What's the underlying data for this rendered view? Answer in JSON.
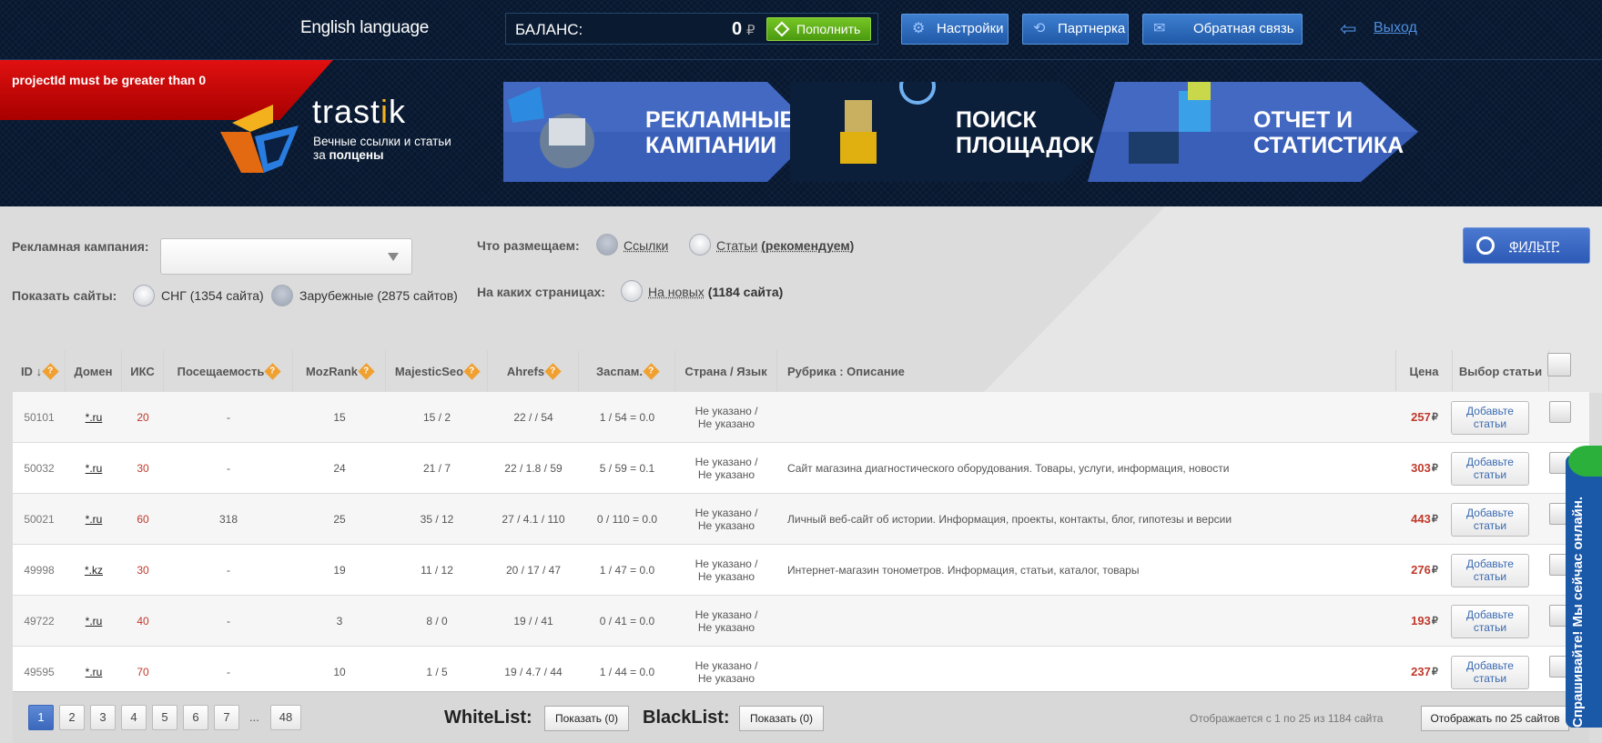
{
  "header": {
    "language": "English language",
    "balance": {
      "label": "БАЛАНС:",
      "amount": "0",
      "currency": "₽",
      "topup_label": "Пополнить"
    },
    "nav": [
      {
        "label": "Настройки",
        "icon": "gear-icon"
      },
      {
        "label": "Партнерка",
        "icon": "refresh-icon"
      },
      {
        "label": "Обратная связь",
        "icon": "mail-icon"
      }
    ],
    "logout_label": "Выход",
    "error_message": "projectId must be greater than 0",
    "logo": {
      "name_a": "trast",
      "name_b": "i",
      "name_c": "k",
      "tagline_a": "Вечные ссылки и статьи",
      "tagline_b": "за ",
      "tagline_c": "полцены"
    },
    "banners": [
      {
        "line1": "РЕКЛАМНЫЕ",
        "line2": "КАМПАНИИ"
      },
      {
        "line1": "ПОИСК",
        "line2": "ПЛОЩАДОК"
      },
      {
        "line1": "ОТЧЕТ И",
        "line2": "СТАТИСТИКА"
      }
    ]
  },
  "filters": {
    "campaign_label": "Рекламная кампания:",
    "show_sites_label": "Показать сайты:",
    "cis_label": "СНГ (1354 сайта)",
    "foreign_label": "Зарубежные (2875 сайтов)",
    "what_label": "Что размещаем:",
    "links_label": "Ссылки",
    "articles_label": "Статьи",
    "articles_note": "(рекомендуем)",
    "pages_label": "На каких страницах:",
    "new_label": "На новых",
    "new_count": "(1184 сайта)",
    "filter_button": "ФИЛЬТР"
  },
  "table": {
    "columns": {
      "id": "ID",
      "sort_arrow": "↓",
      "domain": "Домен",
      "iks": "ИКС",
      "traffic": "Посещаемость",
      "mozrank": "MozRank",
      "majestic": "MajesticSeo",
      "ahrefs": "Ahrefs",
      "spam": "Заспам.",
      "country": "Страна / Язык",
      "rubric": "Рубрика : Описание",
      "price": "Цена",
      "choose": "Выбор статьи"
    },
    "rows": [
      {
        "id": "50101",
        "domain": "*.ru",
        "iks": "20",
        "traffic": "-",
        "mozrank": "15",
        "majestic": "15 / 2",
        "ahrefs": "22 / / 54",
        "spam": "1 / 54 = 0.0",
        "country1": "Не указано /",
        "country2": "Не указано",
        "desc": "",
        "price": "257",
        "add1": "Добавьте",
        "add2": "статьи"
      },
      {
        "id": "50032",
        "domain": "*.ru",
        "iks": "30",
        "traffic": "-",
        "mozrank": "24",
        "majestic": "21 / 7",
        "ahrefs": "22 / 1.8 / 59",
        "spam": "5 / 59 = 0.1",
        "country1": "Не указано /",
        "country2": "Не указано",
        "desc": "Сайт магазина диагностического оборудования. Товары, услуги, информация, новости",
        "price": "303",
        "add1": "Добавьте",
        "add2": "статьи"
      },
      {
        "id": "50021",
        "domain": "*.ru",
        "iks": "60",
        "traffic": "318",
        "mozrank": "25",
        "majestic": "35 / 12",
        "ahrefs": "27 / 4.1 / 110",
        "spam": "0 / 110 = 0.0",
        "country1": "Не указано /",
        "country2": "Не указано",
        "desc": "Личный веб-сайт об истории. Информация, проекты, контакты, блог, гипотезы и версии",
        "price": "443",
        "add1": "Добавьте",
        "add2": "статьи"
      },
      {
        "id": "49998",
        "domain": "*.kz",
        "iks": "30",
        "traffic": "-",
        "mozrank": "19",
        "majestic": "11 / 12",
        "ahrefs": "20 / 17 / 47",
        "spam": "1 / 47 = 0.0",
        "country1": "Не указано /",
        "country2": "Не указано",
        "desc": "Интернет-магазин тонометров. Информация, статьи, каталог, товары",
        "price": "276",
        "add1": "Добавьте",
        "add2": "статьи"
      },
      {
        "id": "49722",
        "domain": "*.ru",
        "iks": "40",
        "traffic": "-",
        "mozrank": "3",
        "majestic": "8 / 0",
        "ahrefs": "19 / / 41",
        "spam": "0 / 41 = 0.0",
        "country1": "Не указано /",
        "country2": "Не указано",
        "desc": "",
        "price": "193",
        "add1": "Добавьте",
        "add2": "статьи"
      },
      {
        "id": "49595",
        "domain": "*.ru",
        "iks": "70",
        "traffic": "-",
        "mozrank": "10",
        "majestic": "1 / 5",
        "ahrefs": "19 / 4.7 / 44",
        "spam": "1 / 44 = 0.0",
        "country1": "Не указано /",
        "country2": "Не указано",
        "desc": "",
        "price": "237",
        "add1": "Добавьте",
        "add2": "статьи"
      }
    ],
    "currency": "₽"
  },
  "pager": {
    "pages": [
      "1",
      "2",
      "3",
      "4",
      "5",
      "6",
      "7"
    ],
    "dots": "...",
    "last": "48",
    "whitelist_label": "WhiteList:",
    "whitelist_btn": "Показать (0)",
    "blacklist_label": "BlackList:",
    "blacklist_btn": "Показать (0)",
    "summary": "Отображается с 1 по 25 из 1184 сайта",
    "per_page": "Отображать по 25 сайтов"
  },
  "chat": {
    "label": "Спрашивайте! Мы сейчас онлайн."
  },
  "colors": {
    "accent": "#2d5ab6",
    "price": "#c0392b",
    "error": "#d00000",
    "topup": "#5aad16"
  }
}
